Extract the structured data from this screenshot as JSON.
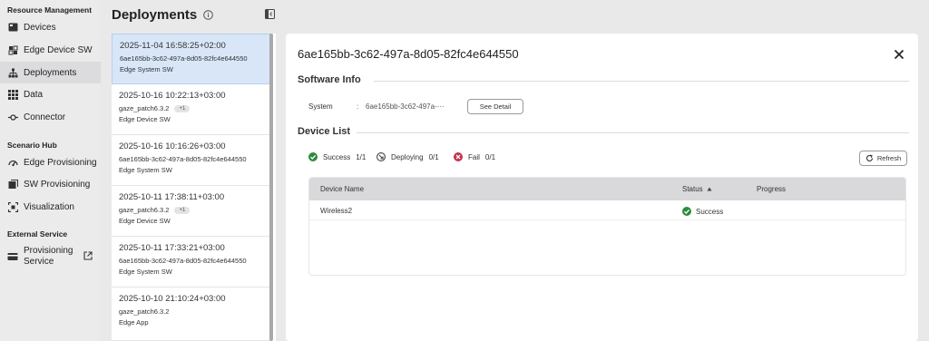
{
  "sidebar": {
    "sections": [
      {
        "title": "Resource Management"
      },
      {
        "title": "Scenario Hub"
      },
      {
        "title": "External Service"
      }
    ],
    "items": [
      {
        "label": "Devices",
        "icon": "devices-icon"
      },
      {
        "label": "Edge Device SW",
        "icon": "chip-icon"
      },
      {
        "label": "Deployments",
        "icon": "deployments-icon",
        "active": true
      },
      {
        "label": "Data",
        "icon": "grid-icon"
      },
      {
        "label": "Connector",
        "icon": "connector-icon"
      },
      {
        "label": "Edge Provisioning",
        "icon": "edge-provisioning-icon"
      },
      {
        "label": "SW Provisioning",
        "icon": "sw-provisioning-icon"
      },
      {
        "label": "Visualization",
        "icon": "visualization-icon"
      },
      {
        "label": "Provisioning Service",
        "icon": "card-icon",
        "external_icon": "external-link-icon"
      }
    ]
  },
  "list": {
    "title": "Deployments",
    "cards": [
      {
        "timestamp": "2025-11-04 16:58:25+02:00",
        "line2": "6ae165bb-3c62-497a-8d05-82fc4e644550",
        "badge": "",
        "line3": "Edge System SW",
        "active": true
      },
      {
        "timestamp": "2025-10-16 10:22:13+03:00",
        "line2": "gaze_patch6.3.2",
        "badge": "+1",
        "line3": "Edge Device SW"
      },
      {
        "timestamp": "2025-10-16 10:16:26+03:00",
        "line2": "6ae165bb-3c62-497a-8d05-82fc4e644550",
        "badge": "",
        "line3": "Edge System SW"
      },
      {
        "timestamp": "2025-10-11 17:38:11+03:00",
        "line2": "gaze_patch6.3.2",
        "badge": "+1",
        "line3": "Edge Device SW"
      },
      {
        "timestamp": "2025-10-11 17:33:21+03:00",
        "line2": "6ae165bb-3c62-497a-8d05-82fc4e644550",
        "badge": "",
        "line3": "Edge System SW"
      },
      {
        "timestamp": "2025-10-10 21:10:24+03:00",
        "line2": "gaze_patch6.3.2",
        "badge": "",
        "line3": "Edge App"
      }
    ]
  },
  "detail": {
    "title": "6ae165bb-3c62-497a-8d05-82fc4e644550",
    "software_info": {
      "heading": "Software Info",
      "label": "System",
      "colon": ":",
      "value": "6ae165bb-3c62-497a-···",
      "button": "See Detail"
    },
    "device_list": {
      "heading": "Device List",
      "summary": [
        {
          "label": "Success",
          "value": "1/1",
          "icon": "success-check-icon",
          "color": "#2e8b3d"
        },
        {
          "label": "Deploying",
          "value": "0/1",
          "icon": "deploying-icon",
          "color": "#555555"
        },
        {
          "label": "Fail",
          "value": "0/1",
          "icon": "fail-x-icon",
          "color": "#c4314b"
        }
      ],
      "refresh_label": "Refresh",
      "columns": [
        "Device Name",
        "Status",
        "Progress"
      ],
      "rows": [
        {
          "device_name": "Wireless2",
          "status": "Success"
        }
      ]
    }
  },
  "colors": {
    "accent_selected": "#d8e6f8",
    "success": "#2e8b3d",
    "fail": "#c4314b"
  }
}
